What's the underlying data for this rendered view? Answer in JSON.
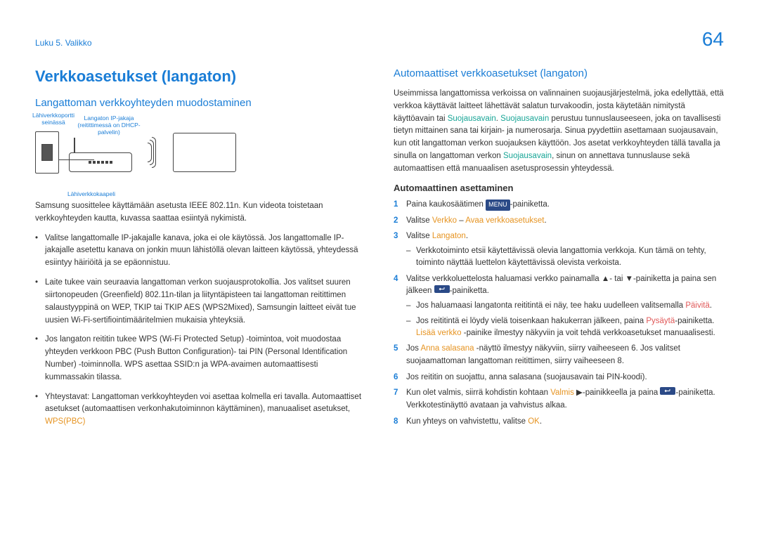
{
  "header": {
    "breadcrumb": "Luku 5. Valikko",
    "page": "64"
  },
  "left": {
    "h1": "Verkkoasetukset (langaton)",
    "h2": "Langattoman verkkoyhteyden muodostaminen",
    "diagram": {
      "port_label": "Lähiverkkoportti seinässä",
      "router_label": "Langaton IP-jakaja (reitittimessä on DHCP-palvelin)",
      "cable_label": "Lähiverkkokaapeli"
    },
    "intro": "Samsung suosittelee käyttämään asetusta IEEE 802.11n. Kun videota toistetaan verkkoyhteyden kautta, kuvassa saattaa esiintyä nykimistä.",
    "bullets": [
      "Valitse langattomalle IP-jakajalle kanava, joka ei ole käytössä. Jos langattomalle IP-jakajalle asetettu kanava on jonkin muun lähistöllä olevan laitteen käytössä, yhteydessä esiintyy häiriöitä ja se epäonnistuu.",
      "Laite tukee vain seuraavia langattoman verkon suojausprotokollia.\nJos valitset suuren siirtonopeuden (Greenfield) 802.11n-tilan ja liityntäpisteen tai langattoman reitittimen salaustyyppinä on WEP, TKIP tai TKIP AES (WPS2Mixed), Samsungin laitteet eivät tue uusien Wi-Fi-sertifiointimääritelmien mukaisia yhteyksiä.",
      "Jos langaton reititin tukee WPS (Wi-Fi Protected Setup) -toimintoa, voit muodostaa yhteyden verkkoon PBC (Push Button Configuration)- tai PIN (Personal Identification Number) -toiminnolla. WPS asettaa SSID:n ja WPA-avaimen automaattisesti kummassakin tilassa.",
      "Yhteystavat: Langattoman verkkoyhteyden voi asettaa kolmella eri tavalla.\nAutomaattiset asetukset (automaattisen verkonhakutoiminnon käyttäminen), manuaaliset asetukset, "
    ],
    "wps_pbc": "WPS(PBC)"
  },
  "right": {
    "h2": "Automaattiset verkkoasetukset (langaton)",
    "p1a": "Useimmissa langattomissa verkoissa on valinnainen suojausjärjestelmä, joka edellyttää, että verkkoa käyttävät laitteet lähettävät salatun turvakoodin, josta käytetään nimitystä käyttöavain tai ",
    "sec_key": "Suojausavain",
    "p1b": ". ",
    "p1c": " perustuu tunnuslauseeseen, joka on tavallisesti tietyn mittainen sana tai kirjain- ja numerosarja. Sinua pyydettiin asettamaan suojausavain, kun otit langattoman verkon suojauksen käyttöön. Jos asetat verkkoyhteyden tällä tavalla ja sinulla on langattoman verkon ",
    "p1d": ", sinun on annettava tunnuslause sekä automaattisen että manuaalisen asetusprosessin yhteydessä.",
    "h3": "Automaattinen asettaminen",
    "step1a": "Paina kaukosäätimen ",
    "menu_chip": "MENU",
    "step1b": "-painiketta.",
    "step2a": "Valitse ",
    "step2_verkko": "Verkko",
    "step2_sep": " – ",
    "step2_avaa": "Avaa verkkoasetukset",
    "step2b": ".",
    "step3a": "Valitse ",
    "step3_langaton": "Langaton",
    "step3b": ".",
    "step3_sub": "Verkkotoiminto etsii käytettävissä olevia langattomia verkkoja. Kun tämä on tehty, toiminto näyttää luettelon käytettävissä olevista verkoista.",
    "step4a": "Valitse verkkoluettelosta haluamasi verkko painamalla ▲- tai ▼-painiketta ja paina sen jälkeen ",
    "step4b": "-painiketta.",
    "step4_sub1a": "Jos haluamaasi langatonta reititintä ei näy, tee haku uudelleen valitsemalla ",
    "step4_sub1_paivita": "Päivitä",
    "step4_sub1b": ".",
    "step4_sub2a": "Jos reititintä ei löydy vielä toisenkaan hakukerran jälkeen, paina ",
    "step4_sub2_pysayta": "Pysäytä",
    "step4_sub2b": "-painiketta. ",
    "step4_sub2_lisaa": "Lisää verkko",
    "step4_sub2c": " -painike ilmestyy näkyviin ja voit tehdä verkkoasetukset manuaalisesti.",
    "step5a": "Jos ",
    "step5_anna": "Anna salasana",
    "step5b": " -näyttö ilmestyy näkyviin, siirry vaiheeseen 6. Jos valitset suojaamattoman langattoman reitittimen, siirry vaiheeseen 8.",
    "step6": "Jos reititin on suojattu, anna salasana (suojausavain tai PIN-koodi).",
    "step7a": "Kun olet valmis, siirrä kohdistin kohtaan ",
    "step7_valmis": "Valmis",
    "step7b": " ▶-painikkeella ja paina ",
    "step7c": "-painiketta. Verkkotestinäyttö avataan ja vahvistus alkaa.",
    "step8a": "Kun yhteys on vahvistettu, valitse ",
    "step8_ok": "OK",
    "step8b": "."
  }
}
